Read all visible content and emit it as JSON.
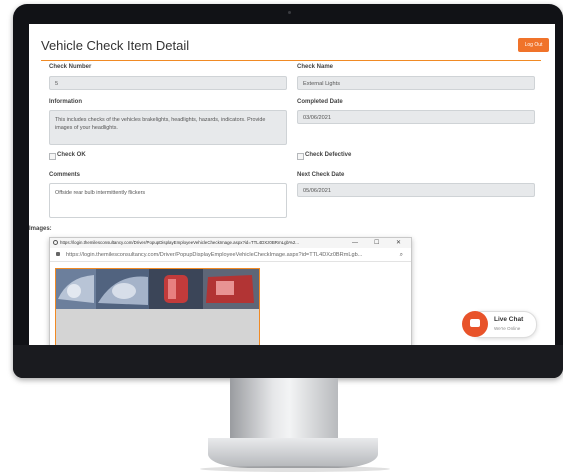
{
  "page": {
    "title": "Vehicle Check Item Detail",
    "logout_label": "Log Out"
  },
  "form": {
    "check_number_label": "Check Number",
    "check_number_value": "5",
    "check_name_label": "Check Name",
    "check_name_value": "External Lights",
    "information_label": "Information",
    "information_value": "This includes checks of the vehicles brakelights, headlights, hazards, indicators. Provide images of your headlights.",
    "completed_date_label": "Completed Date",
    "completed_date_value": "03/06/2021",
    "check_ok_label": "Check OK",
    "check_defective_label": "Check Defective",
    "comments_label": "Comments",
    "comments_value": "Offside rear bulb intermittently flickers",
    "next_check_date_label": "Next Check Date",
    "next_check_date_value": "05/06/2021",
    "images_label": "Images:"
  },
  "popup": {
    "title": "https://login.themilesconsultancy.com/Driver/PopupDisplayEmployeeVehicleCheckImage.aspx?id=TTL4DXz0BRmLgb%2...",
    "address": "https://login.themilesconsultancy.com/Driver/PopupDisplayEmployeeVehicleCheckImage.aspx?id=TTL4DXz0BRmLgb...",
    "minimize": "—",
    "maximize": "☐",
    "close": "✕",
    "zoom_icon": "zoom-icon"
  },
  "chat": {
    "title": "Live Chat",
    "status": "We're Online"
  },
  "colors": {
    "accent": "#f0732a",
    "header_line": "#f08a24",
    "field_bg": "#e7e9eb",
    "chat_icon": "#e8532a"
  }
}
